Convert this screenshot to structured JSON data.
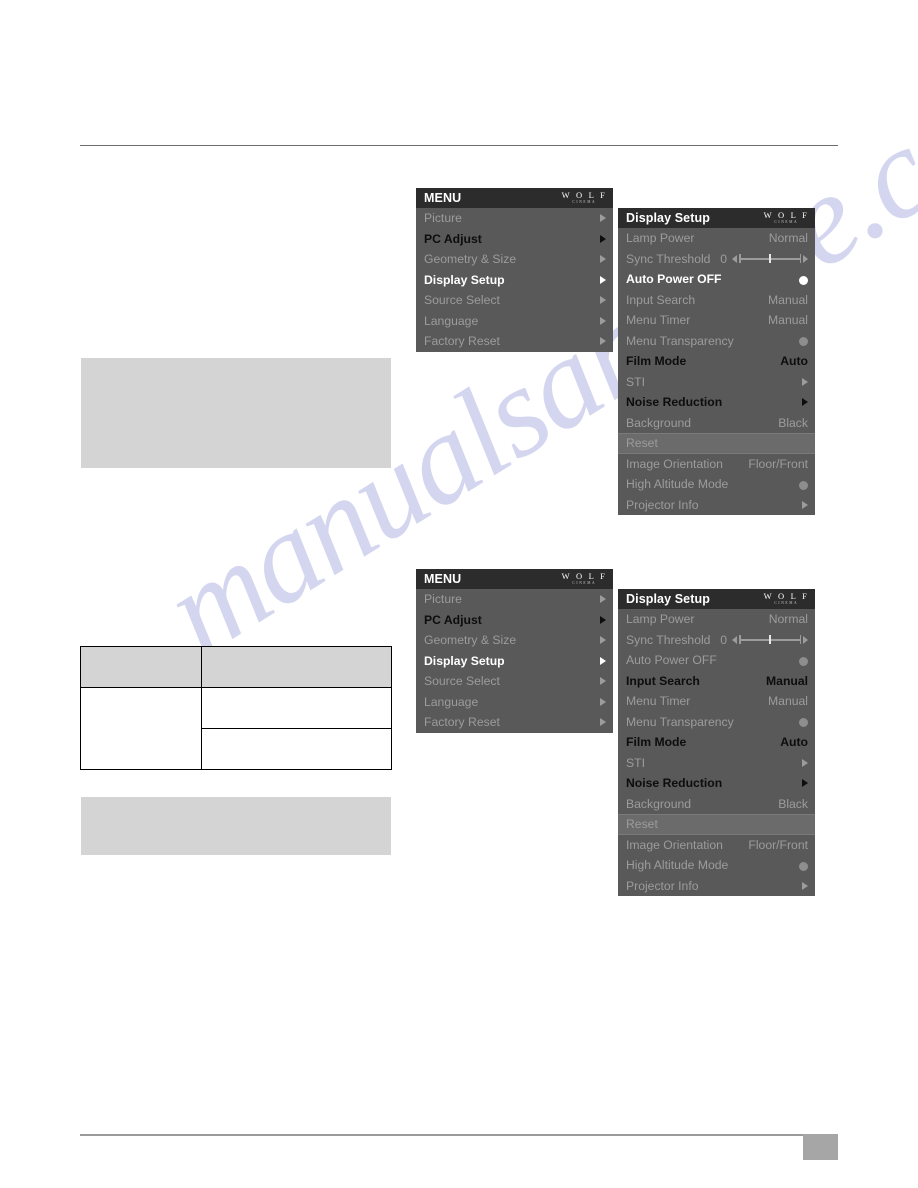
{
  "page": {
    "number": "",
    "watermark": "manualsarchive.com"
  },
  "logo": {
    "main": "W O L F",
    "sub": "CINEMA"
  },
  "menu_root": {
    "title": "MENU",
    "items": [
      {
        "label": "Picture",
        "state": "dim",
        "indicator": "arrow"
      },
      {
        "label": "PC Adjust",
        "state": "dark",
        "indicator": "arrow"
      },
      {
        "label": "Geometry & Size",
        "state": "dim",
        "indicator": "arrow"
      },
      {
        "label": "Display Setup",
        "state": "active",
        "indicator": "arrow"
      },
      {
        "label": "Source Select",
        "state": "dim",
        "indicator": "arrow"
      },
      {
        "label": "Language",
        "state": "dim",
        "indicator": "arrow"
      },
      {
        "label": "Factory Reset",
        "state": "dim",
        "indicator": "arrow"
      }
    ]
  },
  "display_setup_1": {
    "title": "Display Setup",
    "items": [
      {
        "label": "Lamp Power",
        "value": "Normal",
        "state": "dim",
        "indicator": "text"
      },
      {
        "label": "Sync Threshold",
        "value": "0",
        "state": "dim",
        "indicator": "slider"
      },
      {
        "label": "Auto Power OFF",
        "value": "",
        "state": "active",
        "indicator": "dot-bright"
      },
      {
        "label": "Input Search",
        "value": "Manual",
        "state": "dim",
        "indicator": "text"
      },
      {
        "label": "Menu Timer",
        "value": "Manual",
        "state": "dim",
        "indicator": "text"
      },
      {
        "label": "Menu Transparency",
        "value": "",
        "state": "dim",
        "indicator": "dot-dim"
      },
      {
        "label": "Film Mode",
        "value": "Auto",
        "state": "dark",
        "indicator": "text"
      },
      {
        "label": "STI",
        "value": "",
        "state": "dim",
        "indicator": "arrow"
      },
      {
        "label": "Noise Reduction",
        "value": "",
        "state": "dark",
        "indicator": "arrow"
      },
      {
        "label": "Background",
        "value": "Black",
        "state": "dim",
        "indicator": "text"
      },
      {
        "label": "Reset",
        "value": "",
        "state": "dim",
        "indicator": "none",
        "row": "reset"
      },
      {
        "label": "Image Orientation",
        "value": "Floor/Front",
        "state": "dim",
        "indicator": "text"
      },
      {
        "label": "High Altitude Mode",
        "value": "",
        "state": "dim",
        "indicator": "dot-dim"
      },
      {
        "label": "Projector Info",
        "value": "",
        "state": "dim",
        "indicator": "arrow"
      }
    ]
  },
  "display_setup_2": {
    "title": "Display Setup",
    "items": [
      {
        "label": "Lamp Power",
        "value": "Normal",
        "state": "dim",
        "indicator": "text"
      },
      {
        "label": "Sync Threshold",
        "value": "0",
        "state": "dim",
        "indicator": "slider"
      },
      {
        "label": "Auto Power OFF",
        "value": "",
        "state": "dim",
        "indicator": "dot-dim"
      },
      {
        "label": "Input Search",
        "value": "Manual",
        "state": "dark",
        "indicator": "text"
      },
      {
        "label": "Menu Timer",
        "value": "Manual",
        "state": "dim",
        "indicator": "text"
      },
      {
        "label": "Menu Transparency",
        "value": "",
        "state": "dim",
        "indicator": "dot-dim"
      },
      {
        "label": "Film Mode",
        "value": "Auto",
        "state": "dark",
        "indicator": "text"
      },
      {
        "label": "STI",
        "value": "",
        "state": "dim",
        "indicator": "arrow"
      },
      {
        "label": "Noise Reduction",
        "value": "",
        "state": "dark",
        "indicator": "arrow"
      },
      {
        "label": "Background",
        "value": "Black",
        "state": "dim",
        "indicator": "text"
      },
      {
        "label": "Reset",
        "value": "",
        "state": "dim",
        "indicator": "none",
        "row": "reset"
      },
      {
        "label": "Image Orientation",
        "value": "Floor/Front",
        "state": "dim",
        "indicator": "text"
      },
      {
        "label": "High Altitude Mode",
        "value": "",
        "state": "dim",
        "indicator": "dot-dim"
      },
      {
        "label": "Projector Info",
        "value": "",
        "state": "dim",
        "indicator": "arrow"
      }
    ]
  },
  "spec_table": {
    "rows": [
      {
        "left": "",
        "right": "",
        "header": true
      },
      {
        "left": "",
        "right": "",
        "header": false
      },
      {
        "left": "",
        "right": "",
        "header": false
      }
    ]
  },
  "colors": {
    "osd_header": "#2c2c2c",
    "osd_body": "#595959",
    "osd_reset_row": "#6b6b6b",
    "osd_dim_text": "#9c9c9c",
    "osd_active_text": "#ffffff",
    "osd_dark_text": "#0d0d0d",
    "grey_block": "#d4d4d4",
    "watermark": "#9aa0dd"
  }
}
